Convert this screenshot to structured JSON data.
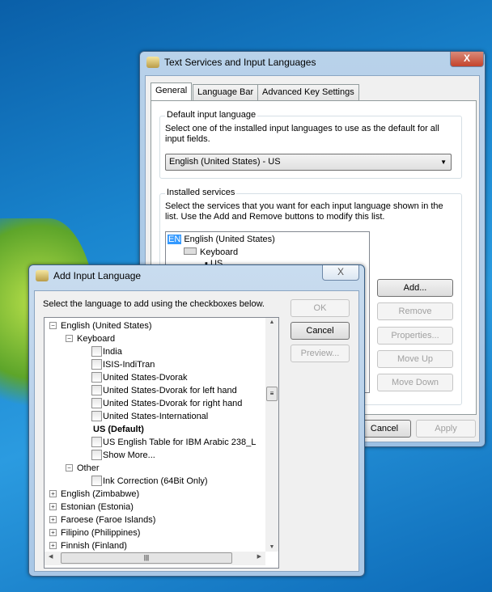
{
  "back_dialog": {
    "title": "Text Services and Input Languages",
    "close": "X",
    "tabs": [
      "General",
      "Language Bar",
      "Advanced Key Settings"
    ],
    "default_group": {
      "label": "Default input language",
      "desc": "Select one of the installed input languages to use as the default for all input fields.",
      "selected": "English (United States) - US"
    },
    "services_group": {
      "label": "Installed services",
      "desc": "Select the services that you want for each input language shown in the list. Use the Add and Remove buttons to modify this list.",
      "tree": {
        "lang_badge": "EN",
        "language": "English (United States)",
        "category": "Keyboard",
        "layout": "US"
      }
    },
    "buttons": {
      "add": "Add...",
      "remove": "Remove",
      "properties": "Properties...",
      "move_up": "Move Up",
      "move_down": "Move Down"
    },
    "footer": {
      "cancel": "Cancel",
      "apply": "Apply"
    }
  },
  "add_dialog": {
    "title": "Add Input Language",
    "close": "X",
    "instruction": "Select the language to add using the checkboxes below.",
    "buttons": {
      "ok": "OK",
      "cancel": "Cancel",
      "preview": "Preview..."
    },
    "tree": [
      {
        "label": "English (United States)",
        "level": 0,
        "expander": "minus"
      },
      {
        "label": "Keyboard",
        "level": 1,
        "expander": "minus"
      },
      {
        "label": "India",
        "level": 2,
        "checkbox": true,
        "checked": false
      },
      {
        "label": "ISIS-IndiTran",
        "level": 2,
        "checkbox": true,
        "checked": false
      },
      {
        "label": "United States-Dvorak",
        "level": 2,
        "checkbox": true,
        "checked": false
      },
      {
        "label": "United States-Dvorak for left hand",
        "level": 2,
        "checkbox": true,
        "checked": false
      },
      {
        "label": "United States-Dvorak for right hand",
        "level": 2,
        "checkbox": true,
        "checked": false
      },
      {
        "label": "United States-International",
        "level": 2,
        "checkbox": true,
        "checked": false
      },
      {
        "label": "US (Default)",
        "level": 2,
        "bold": true
      },
      {
        "label": "US English Table for IBM Arabic 238_L",
        "level": 2,
        "checkbox": true,
        "checked": false
      },
      {
        "label": "Show More...",
        "level": 2,
        "checkbox": true,
        "checked": false
      },
      {
        "label": "Other",
        "level": 1,
        "expander": "minus"
      },
      {
        "label": "Ink Correction (64Bit Only)",
        "level": 2,
        "checkbox": true,
        "checked": false
      },
      {
        "label": "English (Zimbabwe)",
        "level": 0,
        "expander": "plus"
      },
      {
        "label": "Estonian (Estonia)",
        "level": 0,
        "expander": "plus"
      },
      {
        "label": "Faroese (Faroe Islands)",
        "level": 0,
        "expander": "plus"
      },
      {
        "label": "Filipino (Philippines)",
        "level": 0,
        "expander": "plus"
      },
      {
        "label": "Finnish (Finland)",
        "level": 0,
        "expander": "plus"
      }
    ]
  }
}
